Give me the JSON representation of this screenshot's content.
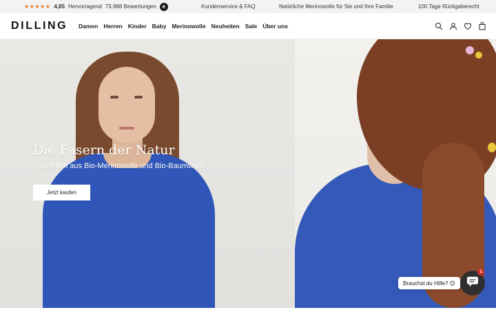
{
  "topbar": {
    "stars": "★★★★★",
    "score": "4,85",
    "rating_word": "Hervorragend",
    "review_count": "73.988 Bewertungen",
    "trust_icon": "trusted-shops-icon",
    "links": [
      "Kundenservice & FAQ",
      "Natürliche Merinowolle für Sie und Ihre Familie",
      "100 Tage Rückgaberecht"
    ]
  },
  "header": {
    "logo": "DILLING",
    "nav": [
      "Damen",
      "Herren",
      "Kinder",
      "Baby",
      "Merinowolle",
      "Neuheiten",
      "Sale",
      "Über uns"
    ],
    "icons": [
      "search-icon",
      "account-icon",
      "heart-icon",
      "bag-icon"
    ]
  },
  "hero": {
    "title": "Die Fasern der Natur",
    "subtitle": "Neuheiten aus Bio-Merinowolle und Bio-Baumwolle",
    "cta": "Jetzt kaufen"
  },
  "chat": {
    "bubble": "Brauchst du Hilfe? 😊",
    "badge": "1",
    "icon": "chat-icon"
  },
  "colors": {
    "star": "#e8742a",
    "garment_blue": "#2f56b8",
    "hair": "#7a3f24",
    "badge": "#d0312d"
  }
}
